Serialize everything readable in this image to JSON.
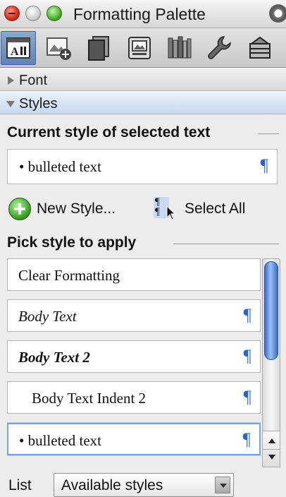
{
  "window": {
    "title": "Formatting Palette"
  },
  "toolbar": {
    "tools": [
      {
        "icon": "formatting-palette-icon",
        "active": true
      },
      {
        "icon": "object-palette-icon",
        "active": false
      },
      {
        "icon": "scrapbook-icon",
        "active": false
      },
      {
        "icon": "reference-tools-icon",
        "active": false
      },
      {
        "icon": "compatibility-report-icon",
        "active": false
      },
      {
        "icon": "project-palette-icon",
        "active": false
      },
      {
        "icon": "toolbox-icon",
        "active": false
      }
    ]
  },
  "sections": {
    "font": {
      "label": "Font",
      "expanded": false
    },
    "styles": {
      "label": "Styles",
      "expanded": true
    }
  },
  "current_style": {
    "heading": "Current style of selected text",
    "value": "• bulleted text",
    "mark": "¶"
  },
  "actions": {
    "new_style": "New Style...",
    "select_all": "Select All"
  },
  "pick_style": {
    "heading": "Pick style to apply",
    "items": [
      {
        "label": "Clear Formatting",
        "mark": "",
        "selected": false
      },
      {
        "label": "Body Text",
        "mark": "¶",
        "selected": false
      },
      {
        "label": "Body Text 2",
        "mark": "¶",
        "selected": false
      },
      {
        "label": "Body Text Indent 2",
        "mark": "¶",
        "selected": false
      },
      {
        "label": "• bulleted text",
        "mark": "¶",
        "selected": true
      }
    ]
  },
  "list_filter": {
    "label": "List",
    "value": "Available styles"
  },
  "colors": {
    "accent_blue": "#2a62d4",
    "selection_border": "#7aa2e0",
    "scroll_thumb": "#3c6fc8",
    "close_red": "#d8281c",
    "zoom_green": "#48b22a"
  }
}
